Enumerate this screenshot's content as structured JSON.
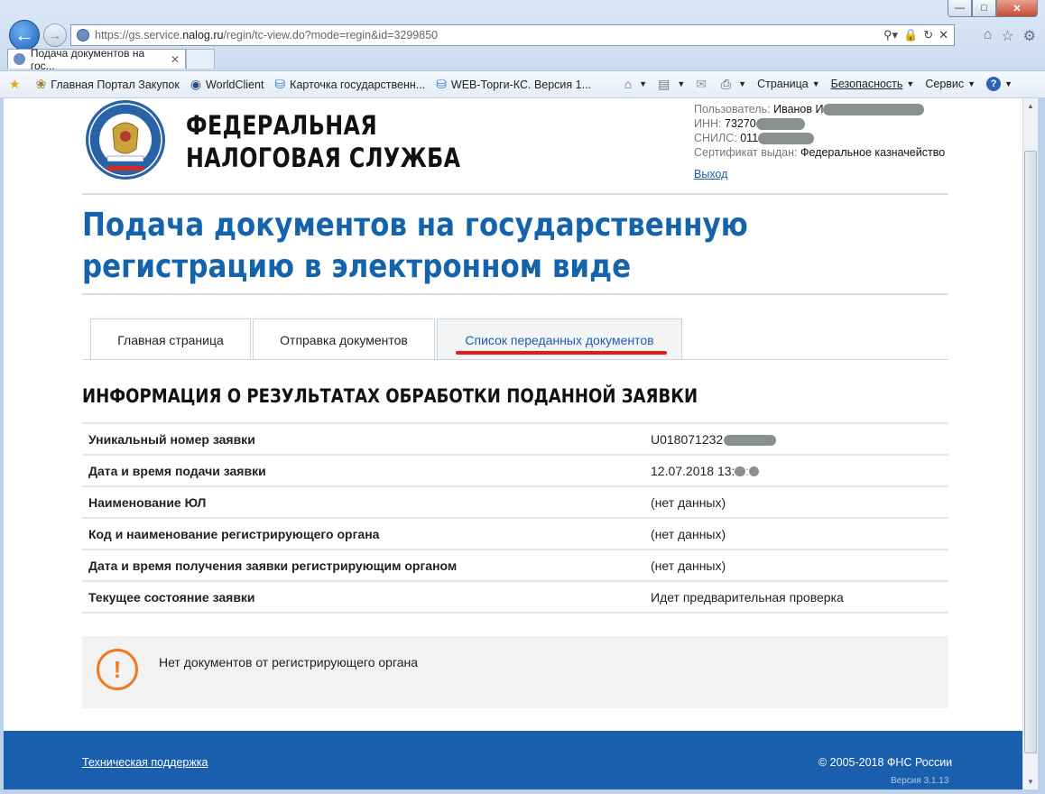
{
  "browser": {
    "url_prefix": "https://gs.service.",
    "url_host": "nalog.ru",
    "url_path": "/regin/tc-view.do?mode=regin&id=3299850",
    "tab_title": "Подача документов на гос...",
    "favorites": [
      {
        "label": "Главная Портал Закупок",
        "icon": "eagle-icon"
      },
      {
        "label": "WorldClient",
        "icon": "globe-icon"
      },
      {
        "label": "Карточка государственн...",
        "icon": "ie-page-icon"
      },
      {
        "label": "WEB-Торги-КС. Версия 1...",
        "icon": "ie-page-icon"
      }
    ],
    "commands": {
      "page": "Страница",
      "safety": "Безопасность",
      "service": "Сервис"
    }
  },
  "header": {
    "brand_line1": "ФЕДЕРАЛЬНАЯ",
    "brand_line2": "НАЛОГОВАЯ СЛУЖБА",
    "user_label": "Пользователь:",
    "user_value": "Иванов И",
    "inn_label": "ИНН:",
    "inn_value": "73270",
    "snils_label": "СНИЛС:",
    "snils_value": "011",
    "cert_label": "Сертификат выдан:",
    "cert_value": "Федеральное казначейство",
    "logout": "Выход"
  },
  "page_title": "Подача документов на государственную регистрацию в электронном виде",
  "tabs": [
    {
      "label": "Главная страница",
      "active": false
    },
    {
      "label": "Отправка документов",
      "active": false
    },
    {
      "label": "Список переданных документов",
      "active": true
    }
  ],
  "section_title": "ИНФОРМАЦИЯ О РЕЗУЛЬТАТАХ ОБРАБОТКИ ПОДАННОЙ ЗАЯВКИ",
  "info_rows": [
    {
      "key": "Уникальный номер заявки",
      "value": "U018071232"
    },
    {
      "key": "Дата и время подачи заявки",
      "value": "12.07.2018 13:"
    },
    {
      "key": "Наименование ЮЛ",
      "value": "(нет данных)"
    },
    {
      "key": "Код и наименование регистрирующего органа",
      "value": "(нет данных)"
    },
    {
      "key": "Дата и время получения заявки регистрирующим органом",
      "value": "(нет данных)"
    },
    {
      "key": "Текущее состояние заявки",
      "value": "Идет предварительная проверка"
    }
  ],
  "notice": {
    "message": "Нет документов от регистрирующего органа",
    "icon": "warning-icon",
    "color": "#f07a22"
  },
  "footer": {
    "support": "Техническая поддержка",
    "copyright": "© 2005-2018 ФНС России",
    "version": "Версия 3.1.13"
  },
  "colors": {
    "brand_blue": "#1464ad",
    "footer_blue": "#1a5fae",
    "active_underline": "#e41b1b"
  }
}
